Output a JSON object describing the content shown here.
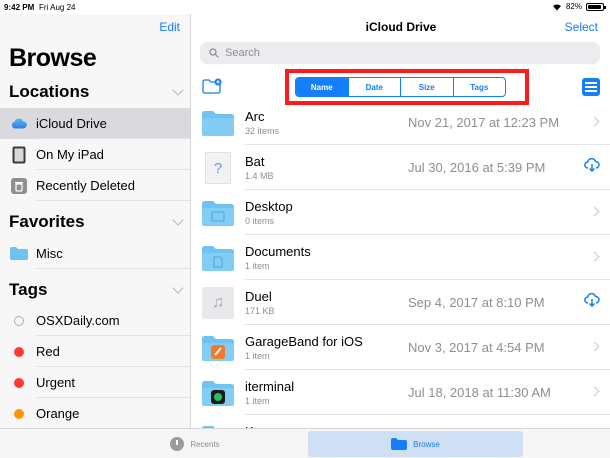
{
  "status_bar": {
    "time": "9:42 PM",
    "date": "Fri Aug 24",
    "battery": "82%"
  },
  "sidebar": {
    "edit_label": "Edit",
    "title": "Browse",
    "locations_label": "Locations",
    "favorites_label": "Favorites",
    "tags_label": "Tags",
    "locations": [
      {
        "label": "iCloud Drive",
        "icon": "cloud-icon",
        "selected": true
      },
      {
        "label": "On My iPad",
        "icon": "ipad-icon",
        "selected": false
      },
      {
        "label": "Recently Deleted",
        "icon": "trash-icon",
        "selected": false
      }
    ],
    "favorites": [
      {
        "label": "Misc",
        "icon": "folder-icon"
      }
    ],
    "tags": [
      {
        "label": "OSXDaily.com",
        "color": ""
      },
      {
        "label": "Red",
        "color": "#ff3b30"
      },
      {
        "label": "Urgent",
        "color": "#ff3b30"
      },
      {
        "label": "Orange",
        "color": "#ff9500"
      }
    ]
  },
  "main": {
    "title": "iCloud Drive",
    "select_label": "Select",
    "search_placeholder": "Search",
    "sort_tabs": [
      {
        "label": "Name",
        "active": true
      },
      {
        "label": "Date",
        "active": false
      },
      {
        "label": "Size",
        "active": false
      },
      {
        "label": "Tags",
        "active": false
      }
    ],
    "files": [
      {
        "name": "Arc",
        "sub": "32 items",
        "date": "Nov 21, 2017 at 12:23 PM",
        "kind": "folder",
        "action": "chevron"
      },
      {
        "name": "Bat",
        "sub": "1.4 MB",
        "date": "Jul 30, 2016 at 5:39 PM",
        "kind": "unknown-file",
        "action": "download"
      },
      {
        "name": "Desktop",
        "sub": "0 items",
        "date": "",
        "kind": "folder-desktop",
        "action": "chevron"
      },
      {
        "name": "Documents",
        "sub": "1 item",
        "date": "",
        "kind": "folder-documents",
        "action": "chevron"
      },
      {
        "name": "Duel",
        "sub": "171 KB",
        "date": "Sep 4, 2017 at 8:10 PM",
        "kind": "audio-file",
        "action": "download"
      },
      {
        "name": "GarageBand for iOS",
        "sub": "1 item",
        "date": "Nov 3, 2017 at 4:54 PM",
        "kind": "folder-garageband",
        "action": "chevron"
      },
      {
        "name": "iterminal",
        "sub": "1 item",
        "date": "Jul 18, 2018 at 11:30 AM",
        "kind": "folder-app",
        "action": "chevron"
      },
      {
        "name": "K",
        "sub": "",
        "date": "",
        "kind": "folder",
        "action": "chevron"
      }
    ]
  },
  "tab_bar": {
    "recents_label": "Recents",
    "browse_label": "Browse"
  },
  "colors": {
    "accent": "#147efb",
    "folder": "#6fc3f0",
    "highlight": "#ff1a1a"
  }
}
